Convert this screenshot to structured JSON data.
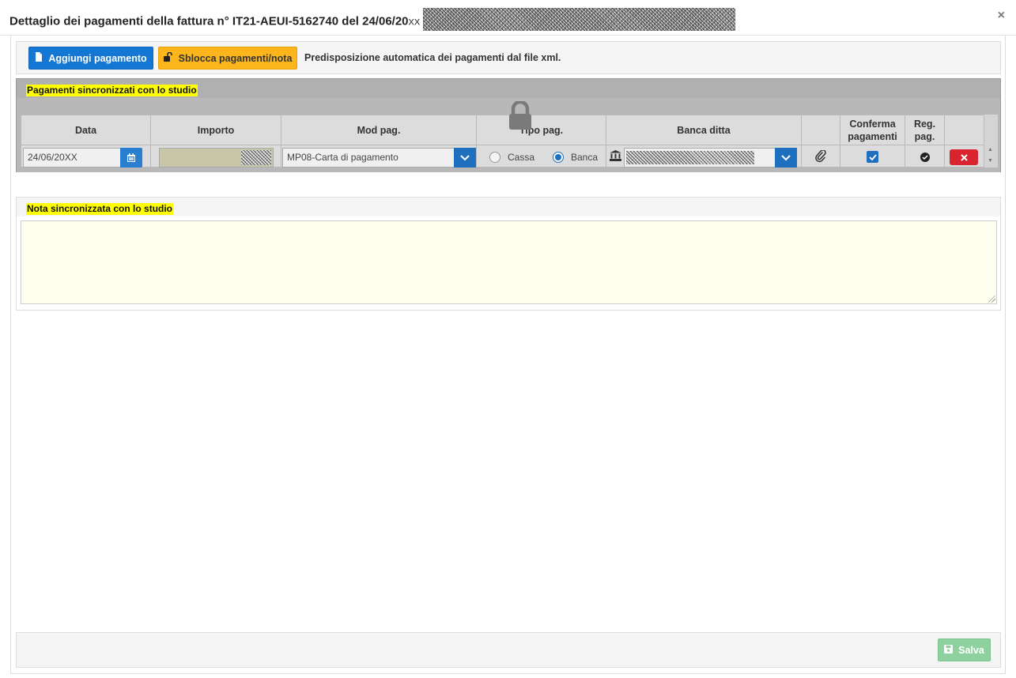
{
  "modal": {
    "title_main": "Dettaglio dei pagamenti della fattura n° IT21-AEUI-5162740 del 24/06/20",
    "title_year_suffix": "XX",
    "close_label": "×"
  },
  "toolbar": {
    "add_label": "Aggiungi pagamento",
    "unlock_label": "Sblocca pagamenti/nota",
    "info_text": "Predisposizione automatica dei pagamenti dal file xml."
  },
  "payments": {
    "section_label": "Pagamenti sincronizzati con lo studio",
    "columns": {
      "data": "Data",
      "importo": "Importo",
      "mod_pag": "Mod pag.",
      "tipo_pag": "Tipo pag.",
      "banca": "Banca ditta",
      "conferma_line1": "Conferma",
      "conferma_line2": "pagamenti",
      "reg_line1": "Reg.",
      "reg_line2": "pag."
    },
    "row": {
      "date": "24/06/20",
      "date_suffix": "XX",
      "mod_pag_value": "MP08-Carta di pagamento",
      "radio_cassa": "Cassa",
      "radio_banca": "Banca",
      "selected_tipo": "Banca",
      "conferma_checked": true
    }
  },
  "note": {
    "section_label": "Nota sincronizzata con lo studio",
    "value": ""
  },
  "footer": {
    "save_label": "Salva"
  },
  "colors": {
    "primary": "#1477d4",
    "warning": "#fcb61b",
    "danger": "#d9232e",
    "success_disabled": "#8fd19e",
    "highlight": "#ffff00"
  }
}
